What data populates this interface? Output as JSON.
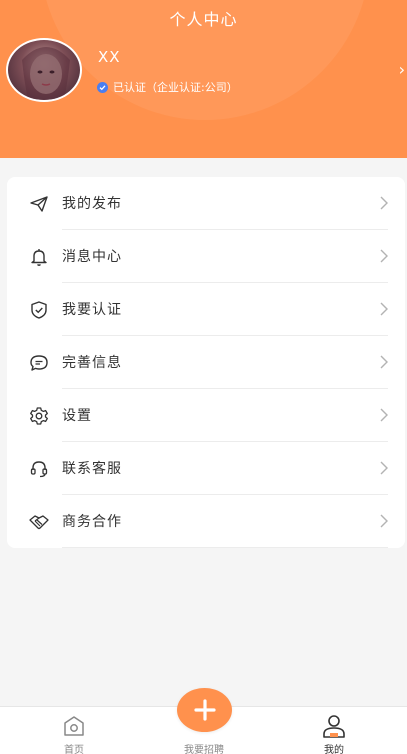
{
  "header": {
    "title": "个人中心",
    "name": "XX",
    "verify_text": "已认证（企业认证:公司）",
    "chevron": "›",
    "brand_color": "#ff914d"
  },
  "menu": {
    "items": [
      {
        "label": "我的发布",
        "icon": "paper-plane-icon"
      },
      {
        "label": "消息中心",
        "icon": "bell-icon"
      },
      {
        "label": "我要认证",
        "icon": "shield-check-icon"
      },
      {
        "label": "完善信息",
        "icon": "chat-bubble-icon"
      },
      {
        "label": "设置",
        "icon": "gear-icon"
      },
      {
        "label": "联系客服",
        "icon": "headset-icon"
      },
      {
        "label": "商务合作",
        "icon": "handshake-icon"
      }
    ]
  },
  "bottom_nav": {
    "tabs": [
      {
        "label": "首页",
        "icon": "home-icon",
        "active": false
      },
      {
        "label": "我要招聘",
        "icon": "plus-icon",
        "active": false
      },
      {
        "label": "我的",
        "icon": "user-icon",
        "active": true
      }
    ]
  }
}
